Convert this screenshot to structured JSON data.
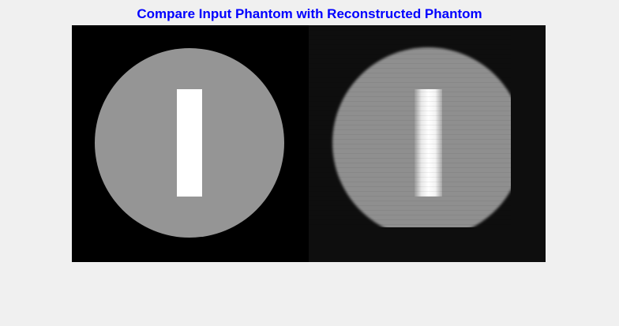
{
  "figure": {
    "title": "Compare Input Phantom with Reconstructed Phantom",
    "title_color": "#0000ff",
    "background_color": "#f0f0f0"
  },
  "panels": [
    {
      "name": "input-phantom",
      "background_color": "#000000",
      "disk_color": "#959595",
      "bar_color": "#ffffff"
    },
    {
      "name": "reconstructed-phantom",
      "background_color": "#0e0e0e",
      "disk_color": "#8f8f8f",
      "bar_color": "#ffffff",
      "artifacts": "blurred edges, horizontal streaks, disk clipped on right and bottom"
    }
  ]
}
